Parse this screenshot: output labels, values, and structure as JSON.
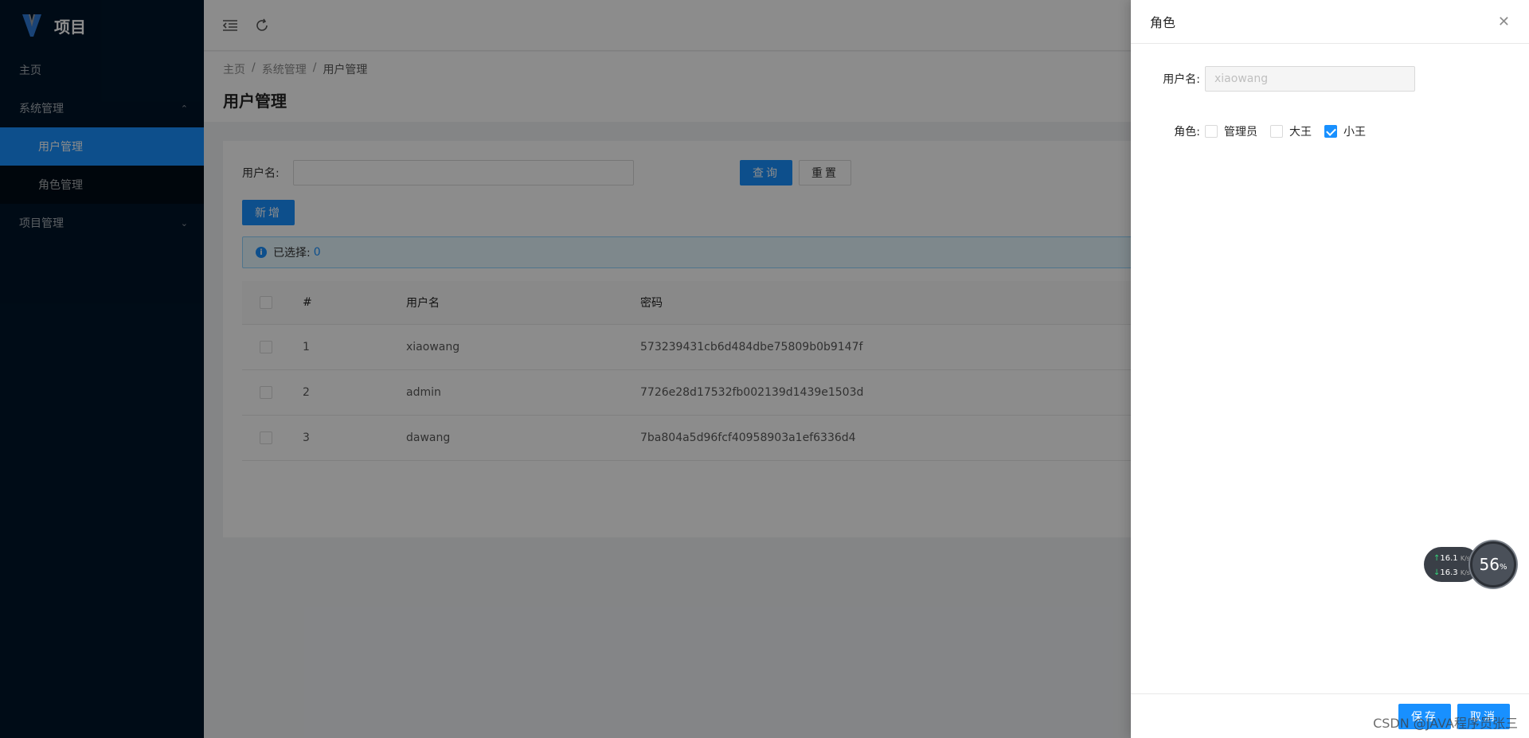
{
  "app": {
    "title": "项目"
  },
  "sidebar": {
    "items": [
      {
        "label": "主页"
      },
      {
        "label": "系统管理",
        "expanded": true,
        "children": [
          {
            "label": "用户管理",
            "active": true
          },
          {
            "label": "角色管理"
          }
        ]
      },
      {
        "label": "项目管理",
        "expanded": false
      }
    ]
  },
  "breadcrumb": [
    "主页",
    "系统管理",
    "用户管理"
  ],
  "page": {
    "title": "用户管理"
  },
  "search": {
    "label": "用户名:",
    "value": "",
    "query_label": "查询",
    "reset_label": "重置"
  },
  "actions": {
    "add_label": "新增"
  },
  "alert": {
    "text": "已选择:",
    "count": "0"
  },
  "table": {
    "headers": [
      "#",
      "用户名",
      "密码"
    ],
    "rows": [
      {
        "idx": "1",
        "username": "xiaowang",
        "password": "573239431cb6d484dbe75809b0b9147f"
      },
      {
        "idx": "2",
        "username": "admin",
        "password": "7726e28d17532fb002139d1439e1503d"
      },
      {
        "idx": "3",
        "username": "dawang",
        "password": "7ba804a5d96fcf40958903a1ef6336d4"
      }
    ]
  },
  "drawer": {
    "title": "角色",
    "username_label": "用户名:",
    "username_value": "xiaowang",
    "role_label": "角色:",
    "roles": [
      {
        "label": "管理员",
        "checked": false
      },
      {
        "label": "大王",
        "checked": false
      },
      {
        "label": "小王",
        "checked": true
      }
    ],
    "save_label": "保存",
    "cancel_label": "取消"
  },
  "network": {
    "up": "16.1",
    "down": "16.3",
    "unit": "K/s",
    "percent": "56",
    "percent_sign": "%"
  },
  "watermark": "CSDN @JAVA程序员张三",
  "colors": {
    "primary": "#1890ff",
    "sidebar": "#001529",
    "submenu": "#000c17"
  }
}
